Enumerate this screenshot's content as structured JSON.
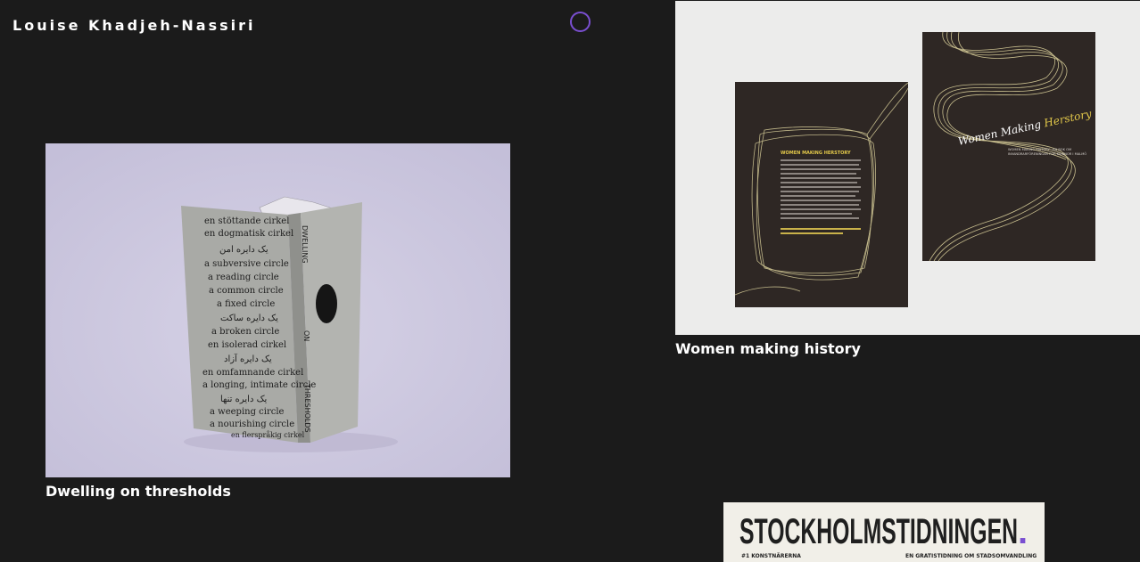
{
  "site": {
    "title": "Louise Khadjeh-Nassiri",
    "accent_color": "#7a4fd1"
  },
  "projects": [
    {
      "caption": "Dwelling on thresholds",
      "image_text": {
        "spine": [
          "DWELLING",
          "ON",
          "THRESHOLDS"
        ],
        "cover_lines": [
          "en stöttande cirkel",
          "en dogmatisk cirkel",
          "یک دایره امن",
          "a subversive circle",
          "a reading circle",
          "a common circle",
          "a fixed circle",
          "یک دایره ساکت",
          "a broken circle",
          "en isolerad cirkel",
          "یک دایره آزاد",
          "en omfamnande cirkel",
          "a longing, intimate circle",
          "یک دایره تنها",
          "a weeping circle",
          "a nourishing circle",
          "en flerspråkig cirkel"
        ]
      }
    },
    {
      "caption": "Women making history",
      "image_text": {
        "back_heading": "WOMEN MAKING HERSTORY",
        "cover_title_a": "Women Making ",
        "cover_title_b": "Herstory",
        "cover_sub_1": "WOMEN MAKING HISTORY - EN BOK OM",
        "cover_sub_2": "INVANDRARFÖRENINGAR FÖR KVINNOR I MALMÖ"
      }
    },
    {
      "caption": "",
      "image_text": {
        "masthead": "STOCKHOLMSTIDNINGEN",
        "masthead_dot": ".",
        "left_tag": "#1 KONSTNÄRERNA",
        "right_tag": "EN GRATISTIDNING OM STADSOMVANDLING"
      }
    }
  ]
}
